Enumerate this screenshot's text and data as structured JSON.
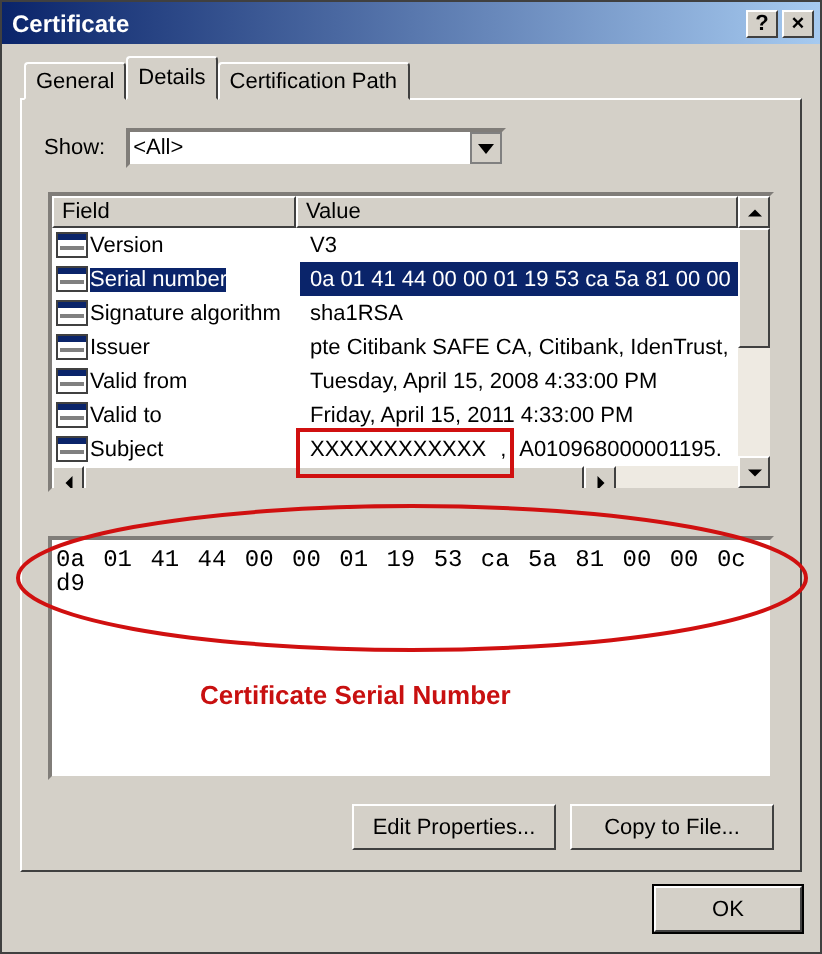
{
  "window": {
    "title": "Certificate",
    "help_button": "?",
    "close_button": "×"
  },
  "tabs": [
    {
      "label": "General",
      "selected": false
    },
    {
      "label": "Details",
      "selected": true
    },
    {
      "label": "Certification Path",
      "selected": false
    }
  ],
  "show": {
    "label": "Show:",
    "value": "<All>"
  },
  "table": {
    "columns": [
      "Field",
      "Value"
    ],
    "rows": [
      {
        "field": "Version",
        "value": "V3",
        "selected": false,
        "highlighted": false
      },
      {
        "field": "Serial number",
        "value": "0a 01 41 44 00 00 01 19 53 ca 5a 81 00 00",
        "selected": true,
        "highlighted": false
      },
      {
        "field": "Signature algorithm",
        "value": "sha1RSA",
        "selected": false,
        "highlighted": false
      },
      {
        "field": "Issuer",
        "value": "pte Citibank SAFE CA, Citibank, IdenTrust,",
        "selected": false,
        "highlighted": false
      },
      {
        "field": "Valid from",
        "value": "Tuesday, April 15, 2008 4:33:00 PM",
        "selected": false,
        "highlighted": false
      },
      {
        "field": "Valid to",
        "value": "Friday, April 15, 2011 4:33:00 PM",
        "selected": false,
        "highlighted": false
      },
      {
        "field": "Subject",
        "value": "XXXXXXXXXXXX , A010968000001195.",
        "selected": false,
        "highlighted": true
      }
    ]
  },
  "details_lines": [
    "0a 01 41 44 00 00 01 19 53 ca 5a 81 00 00 0c",
    "d9"
  ],
  "annotation": "Certificate Serial Number",
  "buttons": [
    "Edit Properties...",
    "Copy to File..."
  ],
  "ok_button": "OK"
}
